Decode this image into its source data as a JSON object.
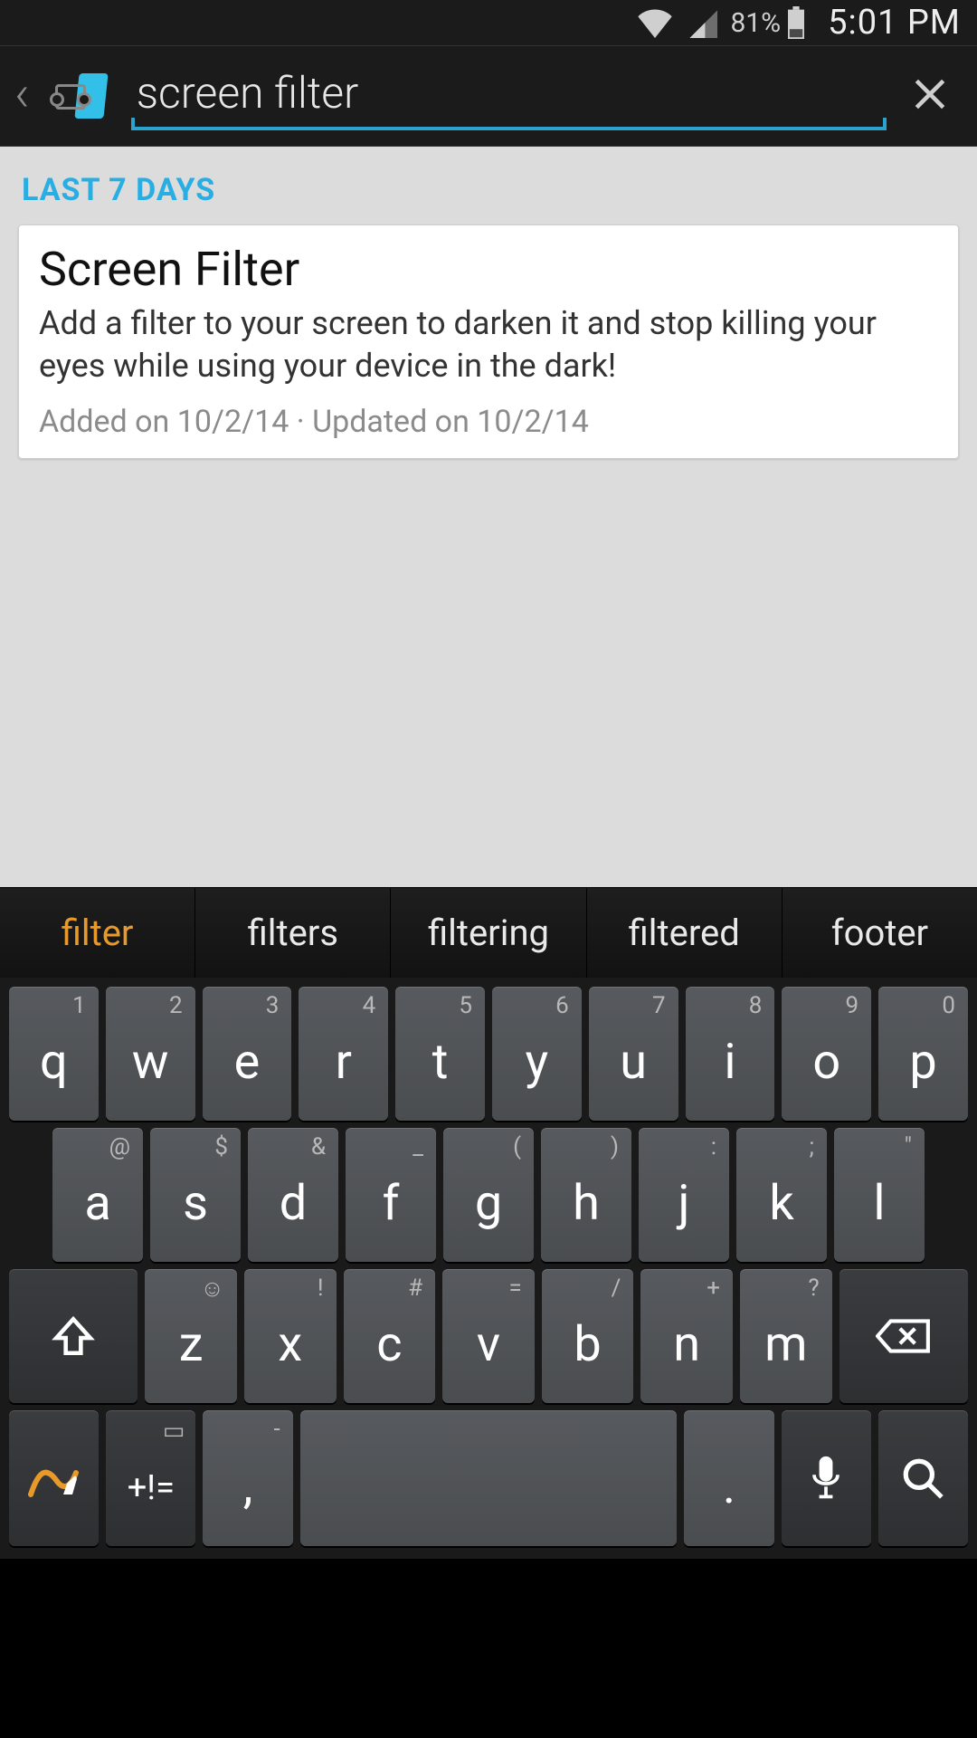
{
  "status": {
    "battery_pct": "81%",
    "time": "5:01 PM"
  },
  "appbar": {
    "search_value": "screen filter"
  },
  "section": {
    "label": "LAST 7 DAYS"
  },
  "result": {
    "title": "Screen Filter",
    "description": "Add a filter to your screen to darken it and stop killing your eyes while using your device in the dark!",
    "meta": "Added on 10/2/14 · Updated on 10/2/14"
  },
  "suggestions": [
    "filter",
    "filters",
    "filtering",
    "filtered",
    "footer"
  ],
  "kbd": {
    "r1": [
      {
        "m": "q",
        "h": "1"
      },
      {
        "m": "w",
        "h": "2"
      },
      {
        "m": "e",
        "h": "3"
      },
      {
        "m": "r",
        "h": "4"
      },
      {
        "m": "t",
        "h": "5"
      },
      {
        "m": "y",
        "h": "6"
      },
      {
        "m": "u",
        "h": "7"
      },
      {
        "m": "i",
        "h": "8"
      },
      {
        "m": "o",
        "h": "9"
      },
      {
        "m": "p",
        "h": "0"
      }
    ],
    "r2": [
      {
        "m": "a",
        "h": "@"
      },
      {
        "m": "s",
        "h": "$"
      },
      {
        "m": "d",
        "h": "&"
      },
      {
        "m": "f",
        "h": "_"
      },
      {
        "m": "g",
        "h": "("
      },
      {
        "m": "h",
        "h": ")"
      },
      {
        "m": "j",
        "h": ":"
      },
      {
        "m": "k",
        "h": ";"
      },
      {
        "m": "l",
        "h": "\""
      }
    ],
    "r3": [
      {
        "m": "z",
        "h": "☺"
      },
      {
        "m": "x",
        "h": "!"
      },
      {
        "m": "c",
        "h": "#"
      },
      {
        "m": "v",
        "h": "="
      },
      {
        "m": "b",
        "h": "/"
      },
      {
        "m": "n",
        "h": "+"
      },
      {
        "m": "m",
        "h": "?"
      }
    ],
    "sym_label": "+!=",
    "comma_main": ",",
    "comma_hint": "-",
    "period_main": ".",
    "space": " "
  }
}
